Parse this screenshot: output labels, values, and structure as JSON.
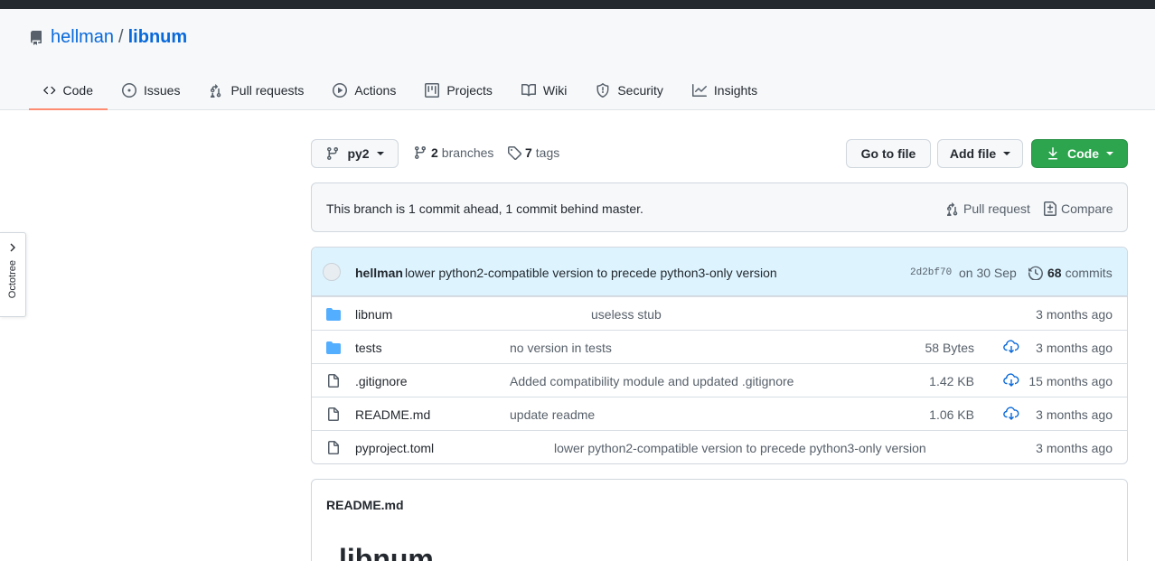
{
  "repo": {
    "owner": "hellman",
    "separator": "/",
    "name": "libnum"
  },
  "tabs": [
    {
      "label": "Code",
      "icon": "code-icon",
      "active": true
    },
    {
      "label": "Issues",
      "icon": "issue-icon"
    },
    {
      "label": "Pull requests",
      "icon": "pull-request-icon"
    },
    {
      "label": "Actions",
      "icon": "play-icon"
    },
    {
      "label": "Projects",
      "icon": "project-icon"
    },
    {
      "label": "Wiki",
      "icon": "book-icon"
    },
    {
      "label": "Security",
      "icon": "shield-icon"
    },
    {
      "label": "Insights",
      "icon": "graph-icon"
    }
  ],
  "octotree": {
    "label": "Octotree"
  },
  "toolbar": {
    "branch": "py2",
    "branches_count": "2",
    "branches_label": "branches",
    "tags_count": "7",
    "tags_label": "tags",
    "go_to_file": "Go to file",
    "add_file": "Add file",
    "code": "Code"
  },
  "ahead_behind": {
    "text": "This branch is 1 commit ahead, 1 commit behind master.",
    "pull_request": "Pull request",
    "compare": "Compare"
  },
  "latest_commit": {
    "author": "hellman",
    "message": "lower python2-compatible version to precede python3-only version",
    "sha": "2d2bf70",
    "date": "on 30 Sep",
    "commits_count": "68",
    "commits_label": "commits"
  },
  "files": [
    {
      "name": "libnum",
      "type": "folder",
      "message": "useless stub",
      "size": "",
      "age": "3 months ago"
    },
    {
      "name": "tests",
      "type": "folder",
      "message": "no version in tests",
      "size": "58 Bytes",
      "age": "3 months ago"
    },
    {
      "name": ".gitignore",
      "type": "file",
      "message": "Added compatibility module and updated .gitignore",
      "size": "1.42 KB",
      "age": "15 months ago"
    },
    {
      "name": "README.md",
      "type": "file",
      "message": "update readme",
      "size": "1.06 KB",
      "age": "3 months ago"
    },
    {
      "name": "pyproject.toml",
      "type": "file",
      "message": "lower python2-compatible version to precede python3-only version",
      "size": "",
      "age": "3 months ago"
    }
  ],
  "readme": {
    "title": "README.md",
    "heading": "libnum"
  },
  "colors": {
    "accent": "#0969da",
    "green": "#2da44e",
    "folder": "#54aeff",
    "tab_underline": "#fd8c73",
    "commit_bg": "#ddf4ff"
  }
}
